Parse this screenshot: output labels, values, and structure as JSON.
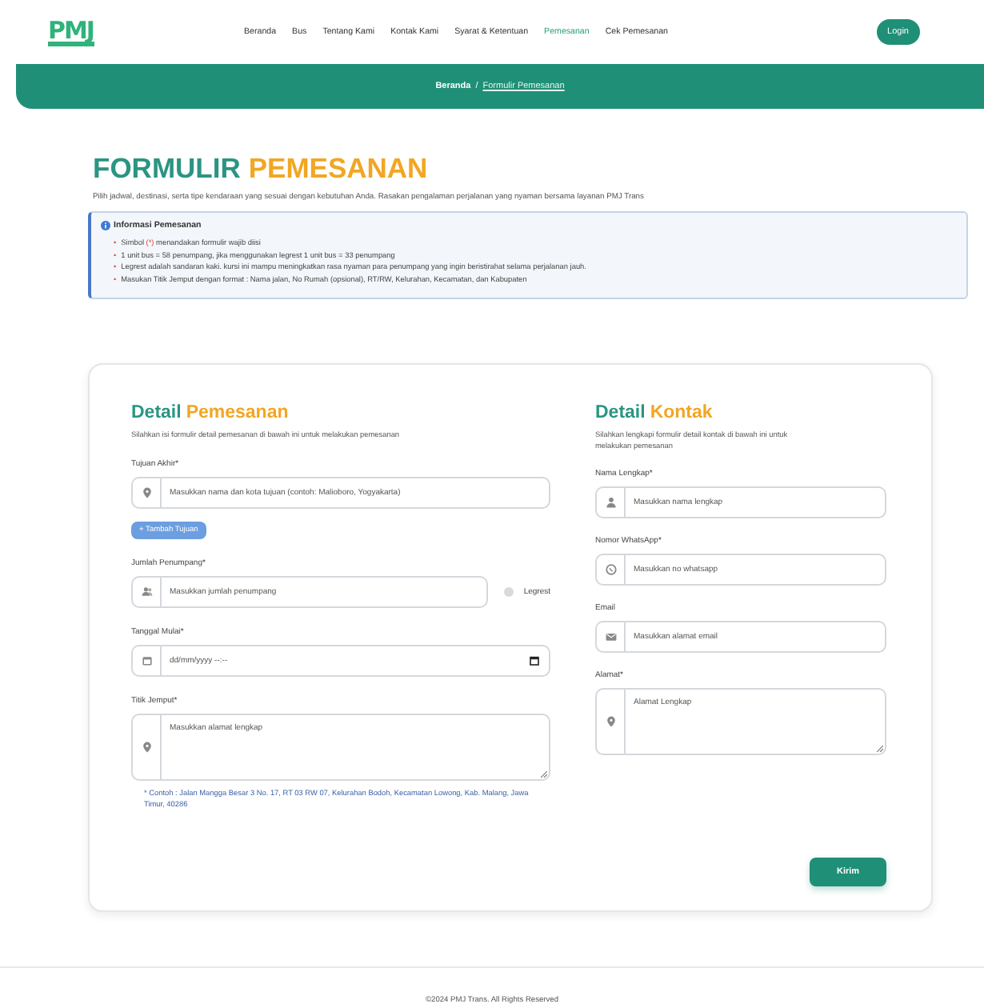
{
  "header": {
    "logo": "PMJ",
    "nav": [
      {
        "label": "Beranda",
        "selected": false
      },
      {
        "label": "Bus",
        "selected": false
      },
      {
        "label": "Tentang Kami",
        "selected": false
      },
      {
        "label": "Kontak Kami",
        "selected": false
      },
      {
        "label": "Syarat & Ketentuan",
        "selected": false
      },
      {
        "label": "Pemesanan",
        "selected": true
      },
      {
        "label": "Cek Pemesanan",
        "selected": false
      }
    ],
    "login": "Login"
  },
  "breadcrumb": {
    "home": "Beranda",
    "separator": "/",
    "current": "Formulir Pemesanan"
  },
  "heading": {
    "title_part1": "FORMULIR",
    "title_part2": "PEMESANAN",
    "subtitle": "Pilih jadwal, destinasi, serta tipe kendaraan yang sesuai dengan kebutuhan Anda. Rasakan pengalaman perjalanan yang nyaman bersama layanan PMJ Trans"
  },
  "info": {
    "title": "Informasi Pemesanan",
    "bullet": "•",
    "items": [
      {
        "kind": "required-note",
        "before": "Simbol",
        "mark": "(*)",
        "after": "menandakan formulir wajib diisi"
      },
      {
        "kind": "plain",
        "text": "1 unit bus = 58 penumpang, jika menggunakan legrest 1 unit bus = 33 penumpang"
      },
      {
        "kind": "plain",
        "text": "Legrest adalah sandaran kaki. kursi ini mampu meningkatkan rasa nyaman para penumpang yang ingin beristirahat selama perjalanan jauh."
      },
      {
        "kind": "plain",
        "text": "Masukan Titik Jemput dengan format : Nama jalan, No Rumah (opsional), RT/RW, Kelurahan, Kecamatan, dan Kabupaten"
      }
    ]
  },
  "order": {
    "title_part1": "Detail",
    "title_part2": "Pemesanan",
    "description": "Silahkan isi formulir detail pemesanan di bawah ini untuk melakukan pemesanan",
    "fields": [
      {
        "kind": "input",
        "label": "Tujuan Akhir*",
        "placeholder": "Masukkan nama dan kota tujuan (contoh: Malioboro, Yogyakarta)",
        "action": "+ Tambah Tujuan"
      },
      {
        "kind": "input",
        "label": "Jumlah Penumpang*",
        "placeholder": "Masukkan jumlah penumpang",
        "option": {
          "label": "Legrest",
          "checked": false
        }
      },
      {
        "kind": "date",
        "label": "Tanggal Mulai*",
        "placeholder": "dd/mm/yyyy --:--"
      },
      {
        "kind": "textarea",
        "label": "Titik Jemput*",
        "placeholder": "Masukkan alamat lengkap",
        "hint": "* Contoh : Jalan Mangga Besar 3 No. 17, RT 03 RW 07, Kelurahan Bodoh, Kecamatan Lowong, Kab. Malang, Jawa Timur, 40286"
      }
    ]
  },
  "contact": {
    "title_part1": "Detail",
    "title_part2": "Kontak",
    "description": "Silahkan lengkapi formulir detail kontak di bawah ini untuk melakukan pemesanan",
    "fields": [
      {
        "kind": "input",
        "label": "Nama Lengkap*",
        "placeholder": "Masukkan nama lengkap"
      },
      {
        "kind": "input",
        "label": "Nomor WhatsApp*",
        "placeholder": "Masukkan no whatsapp"
      },
      {
        "kind": "input",
        "label": "Email",
        "placeholder": "Masukkan alamat email"
      },
      {
        "kind": "textarea",
        "label": "Alamat*",
        "placeholder": "Alamat Lengkap"
      }
    ]
  },
  "submit": "Kirim",
  "footer": "©2024 PMJ Trans. All Rights Reserved"
}
